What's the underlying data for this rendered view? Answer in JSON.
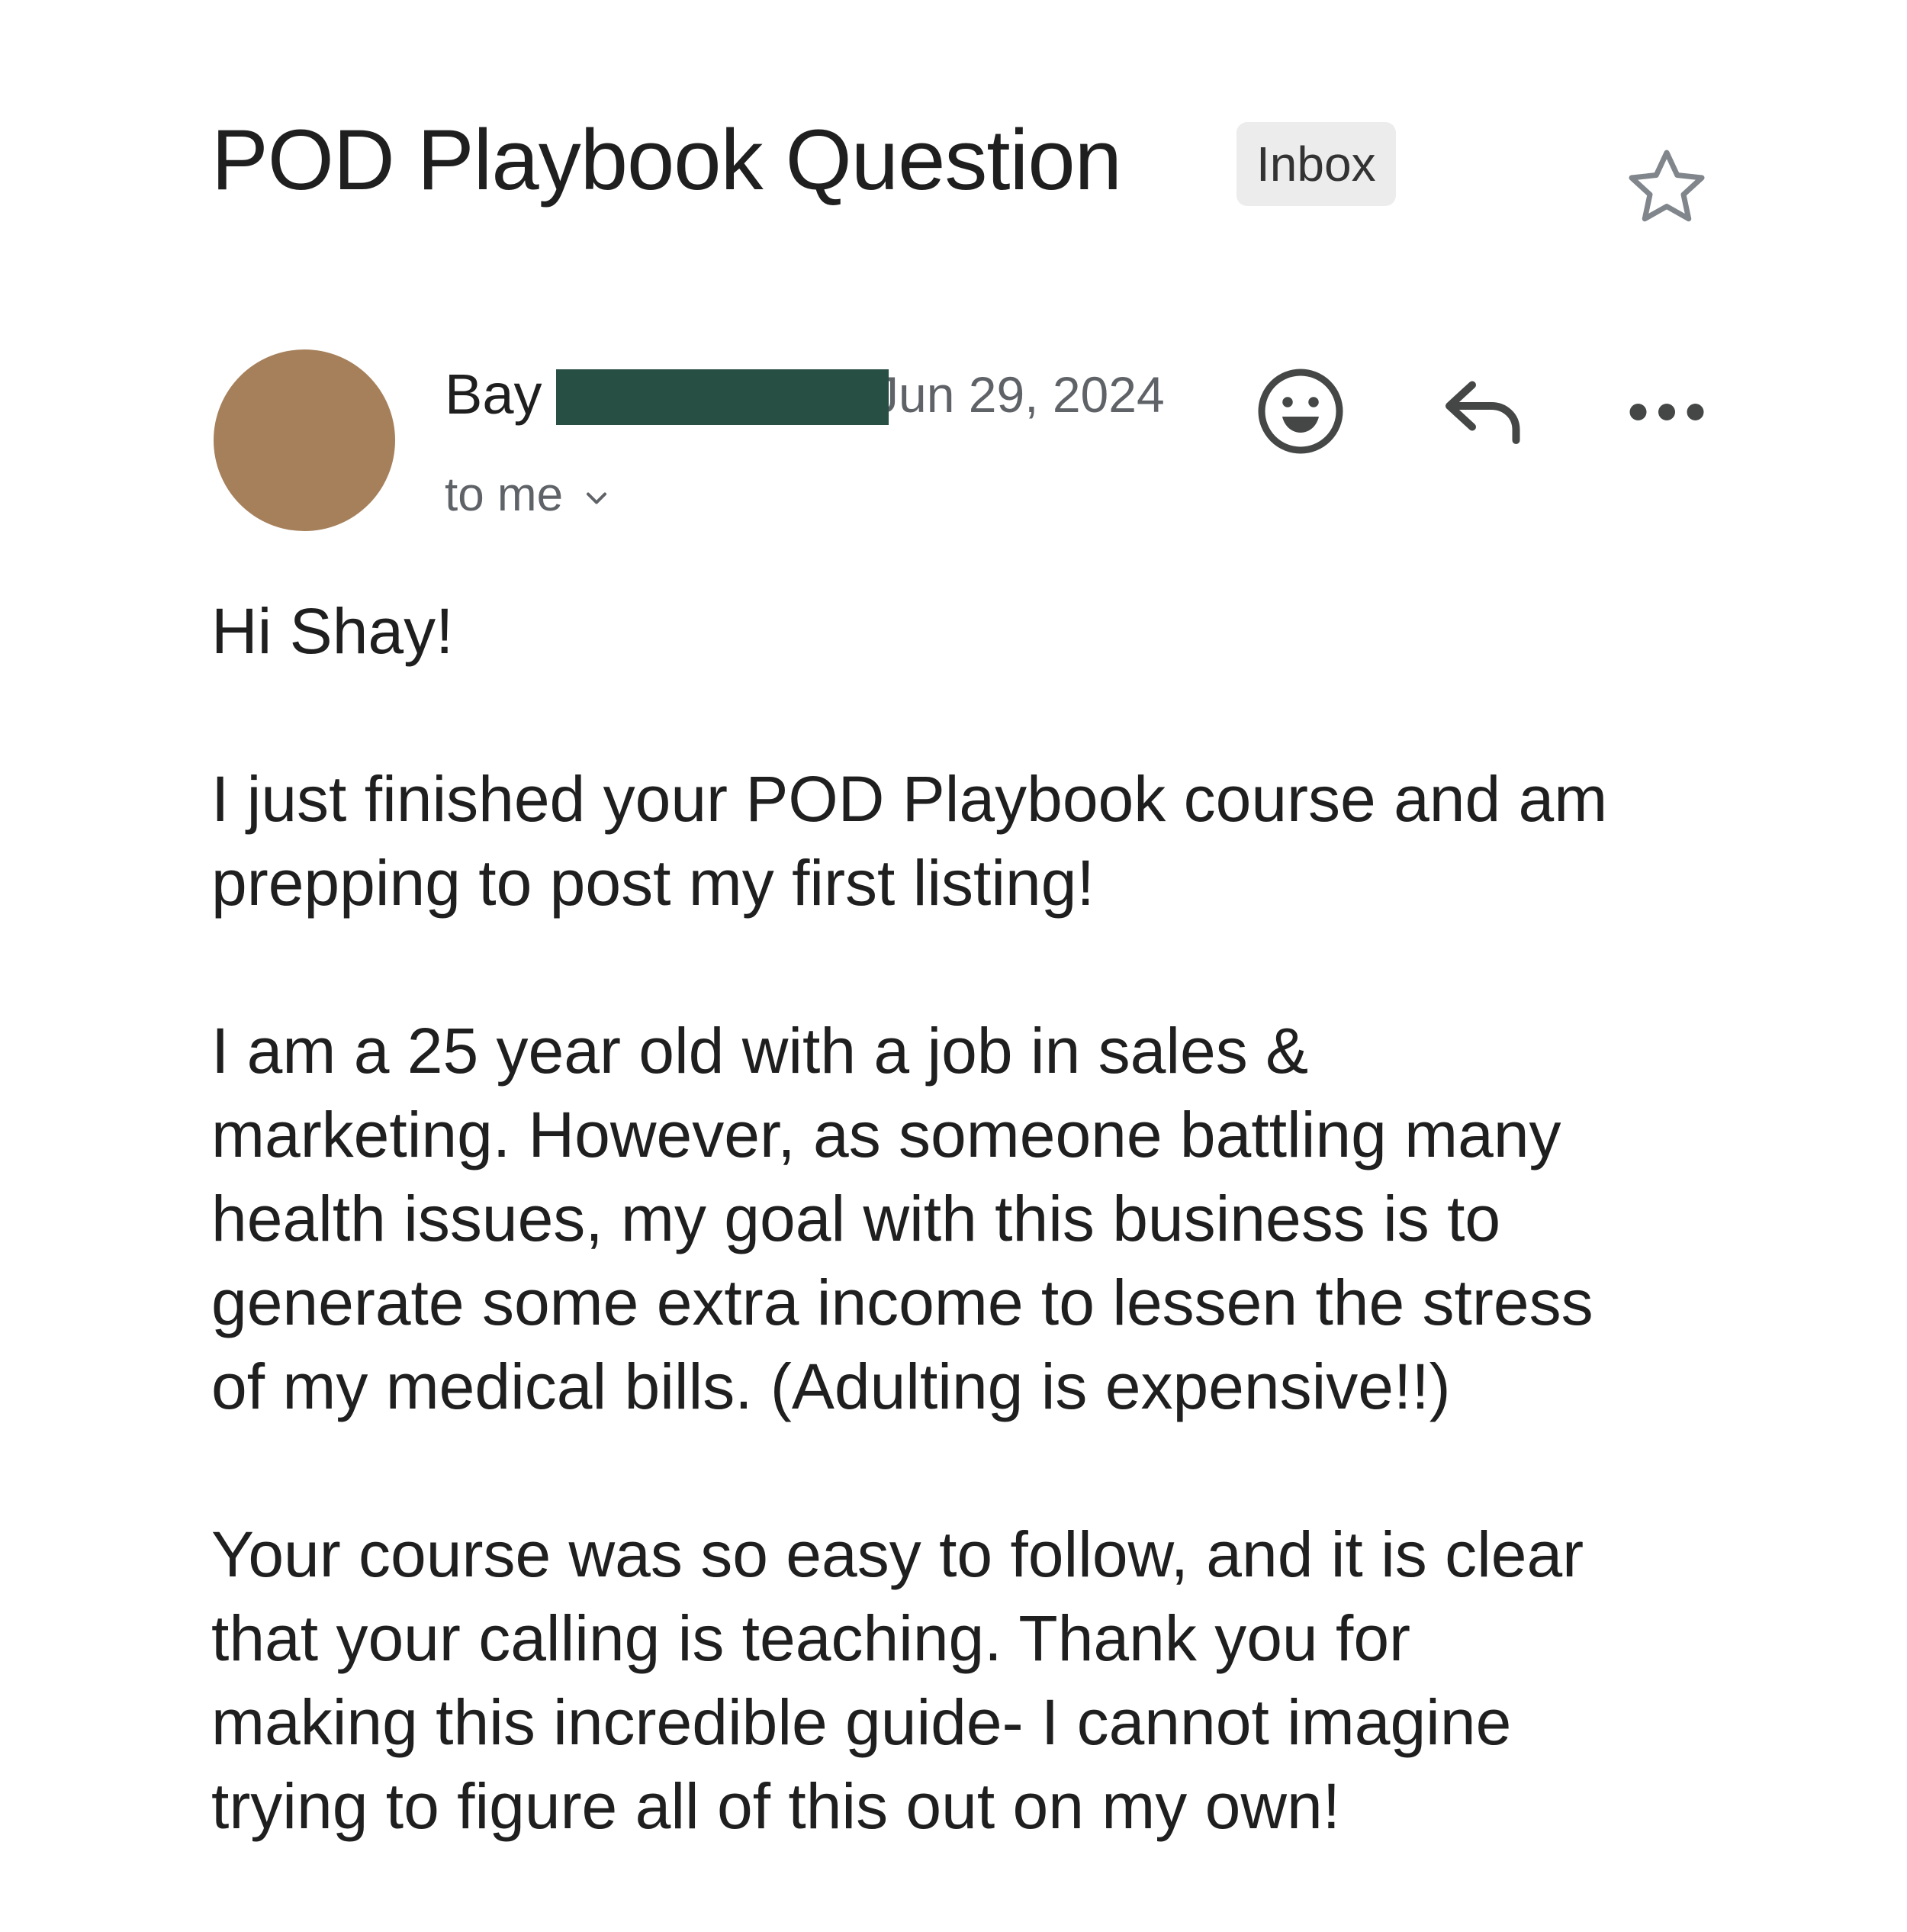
{
  "subject": "POD Playbook Question",
  "label_badge": "Inbox",
  "icons": {
    "star": "star-outline-icon",
    "emoji": "smiley-icon",
    "reply": "reply-arrow-icon",
    "more": "more-horizontal-icon",
    "chevron": "chevron-down-icon"
  },
  "colors": {
    "avatar": "#a6805b",
    "redaction": "#274f43",
    "badge_bg": "#ececec",
    "secondary_text": "#5f6368"
  },
  "sender": {
    "name": "Bay",
    "date": "Jun 29, 2024",
    "recipients": "to me"
  },
  "body": {
    "paragraphs": [
      "Hi Shay!",
      "I just finished your POD Playbook course and am\nprepping to post my first listing!",
      "I am a 25 year old with a job in sales &\nmarketing. However, as someone battling many\nhealth issues, my goal with this business is to\ngenerate some extra income to lessen the stress\nof my medical bills. (Adulting is expensive!!)",
      "Your course was so easy to follow, and it is clear\nthat your calling is teaching. Thank you for\nmaking this incredible guide- I cannot imagine\ntrying to figure all of this out on my own!"
    ]
  }
}
